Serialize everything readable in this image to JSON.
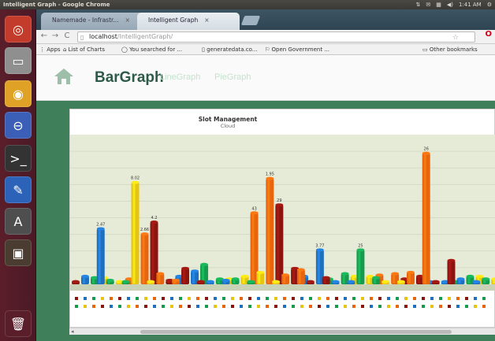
{
  "top_panel": {
    "window_title": "Intelligent Graph - Google Chrome",
    "indicators": [
      "⇅",
      "✉",
      "▦",
      "◀)",
      "1:41 AM",
      "⚙"
    ]
  },
  "launcher": {
    "items": [
      {
        "name": "ubuntu-software-icon",
        "glyph": "◎",
        "color": "#c33b2b"
      },
      {
        "name": "files-icon",
        "glyph": "▭",
        "color": "#8f8f8f"
      },
      {
        "name": "chrome-icon",
        "glyph": "◉",
        "color": "#e0a127"
      },
      {
        "name": "disk-icon",
        "glyph": "⊖",
        "color": "#3b5fb7"
      },
      {
        "name": "terminal-icon",
        "glyph": ">_",
        "color": "#333333"
      },
      {
        "name": "app-icon",
        "glyph": "✎",
        "color": "#2c63b8"
      },
      {
        "name": "update-icon",
        "glyph": "A",
        "color": "#4e4e4e"
      },
      {
        "name": "workspace-icon",
        "glyph": "▣",
        "color": "#4a3c30"
      },
      {
        "name": "trash-icon",
        "glyph": "🗑",
        "color": "#5a1e2a"
      }
    ]
  },
  "browser": {
    "tabs": [
      {
        "label": "Namemade - Infrastr...",
        "active": false
      },
      {
        "label": "Intelligent Graph",
        "active": true
      }
    ],
    "url_host": "localhost",
    "url_path": "/IntelligentGraph/",
    "bookmarks": [
      "Apps",
      "List of Charts",
      "You searched for ...",
      "generatedata.co...",
      "Open Government ...",
      "Other bookmarks"
    ]
  },
  "nav": {
    "bar_graph": "BarGraph",
    "line_graph": "LineGraph",
    "pie_graph": "PieGraph"
  },
  "chart_data": {
    "type": "bar",
    "title": "Slot Management",
    "subtitle": "Cloud",
    "ylim": [
      0,
      100
    ],
    "colors": [
      "#8a1510",
      "#1f6fbf",
      "#169b4d",
      "#e5c512",
      "#e8650f"
    ],
    "groups": [
      {
        "values": [
          2,
          6,
          5,
          5
        ]
      },
      {
        "values": [
          42,
          3,
          2,
          4
        ]
      },
      {
        "values": [
          2,
          77,
          38,
          47
        ]
      },
      {
        "values": [
          2,
          8,
          3,
          6
        ]
      },
      {
        "values": [
          3,
          12,
          10,
          15
        ]
      },
      {
        "values": [
          2,
          2,
          4,
          4
        ]
      },
      {
        "values": [
          3,
          4,
          6,
          54
        ]
      },
      {
        "values": [
          2,
          9,
          80,
          60
        ]
      },
      {
        "values": [
          2,
          7,
          12,
          6
        ]
      },
      {
        "values": [
          11,
          2,
          26,
          4
        ]
      },
      {
        "values": [
          5,
          2,
          8,
          6
        ]
      },
      {
        "values": [
          2,
          26,
          6,
          7
        ]
      },
      {
        "values": [
          5,
          2,
          8,
          4
        ]
      },
      {
        "values": [
          2,
          9,
          6,
          2
        ]
      },
      {
        "values": [
          99,
          2,
          2,
          2
        ]
      },
      {
        "values": [
          18,
          4,
          6,
          6
        ]
      },
      {
        "values": [
          2,
          4,
          4,
          9
        ]
      }
    ],
    "data_labels": [
      "2.47",
      "8.02",
      "2.66",
      "4.2",
      "43",
      "1.95",
      "29",
      "3.77",
      "25",
      "26",
      "11",
      "28",
      "8.98",
      "21",
      "9",
      "22",
      "19",
      "8.4",
      "60",
      "1.88",
      "11",
      "18",
      "79",
      "62",
      "99",
      "22",
      "15",
      "13"
    ],
    "legend_count": 48
  },
  "scrollbar": {
    "left_arrow": "◂"
  }
}
